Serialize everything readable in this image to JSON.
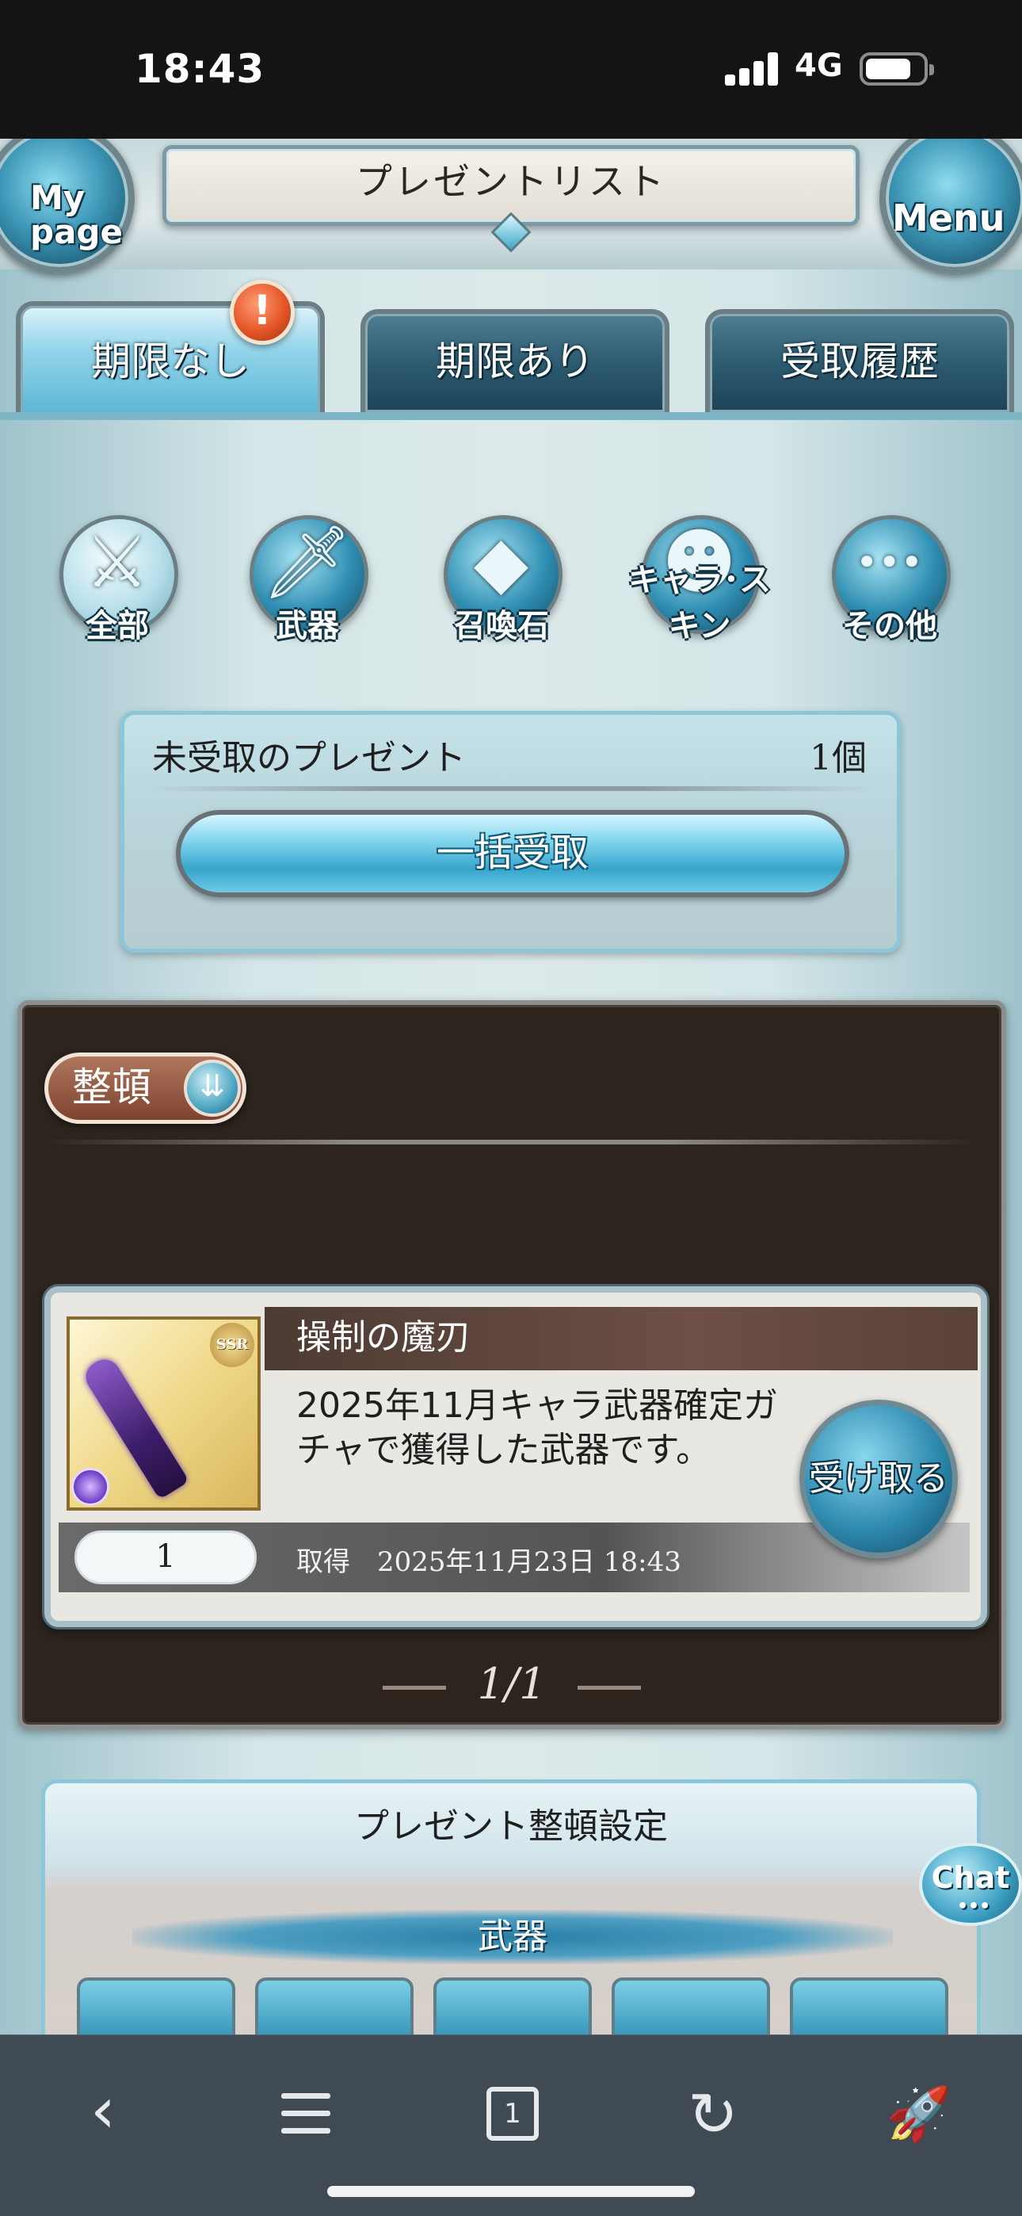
{
  "status_bar": {
    "time": "18:43",
    "network": "4G"
  },
  "header": {
    "title": "プレゼントリスト",
    "mypage_line1": "My",
    "mypage_line2": "page",
    "menu_label": "Menu"
  },
  "tabs": [
    {
      "label": "期限なし",
      "active": true
    },
    {
      "label": "期限あり",
      "active": false
    },
    {
      "label": "受取履歴",
      "active": false
    }
  ],
  "tab_badge": "!",
  "categories": [
    {
      "label": "全部",
      "icon": "all-items-icon",
      "glyph": "⚔"
    },
    {
      "label": "武器",
      "icon": "weapon-icon",
      "glyph": "🗡"
    },
    {
      "label": "召喚石",
      "icon": "summon-stone-icon",
      "glyph": "◆"
    },
    {
      "label": "キャラ･スキン",
      "icon": "character-icon",
      "glyph": "☻"
    },
    {
      "label": "その他",
      "icon": "more-icon",
      "glyph": "•••"
    }
  ],
  "unreceived": {
    "label": "未受取のプレゼント",
    "count": "1個",
    "claim_all_label": "一括受取"
  },
  "list": {
    "sort_label": "整頓",
    "items": [
      {
        "name": "操制の魔刃",
        "description": "2025年11月キャラ武器確定ガチャで獲得した武器です。",
        "rarity": "SSR",
        "quantity": "1",
        "acquired_label": "取得",
        "acquired_date": "2025年11月23日 18:43",
        "receive_label": "受け取る"
      }
    ],
    "pagination": "1/1"
  },
  "settings": {
    "title": "プレゼント整頓設定",
    "section": "武器"
  },
  "chat": {
    "label": "Chat",
    "dots": "•••"
  },
  "browser_toolbar": {
    "tab_count": "1"
  },
  "colors": {
    "accent_blue": "#37a5cc",
    "dark_panel": "#2c241d",
    "badge_orange": "#e45727"
  }
}
